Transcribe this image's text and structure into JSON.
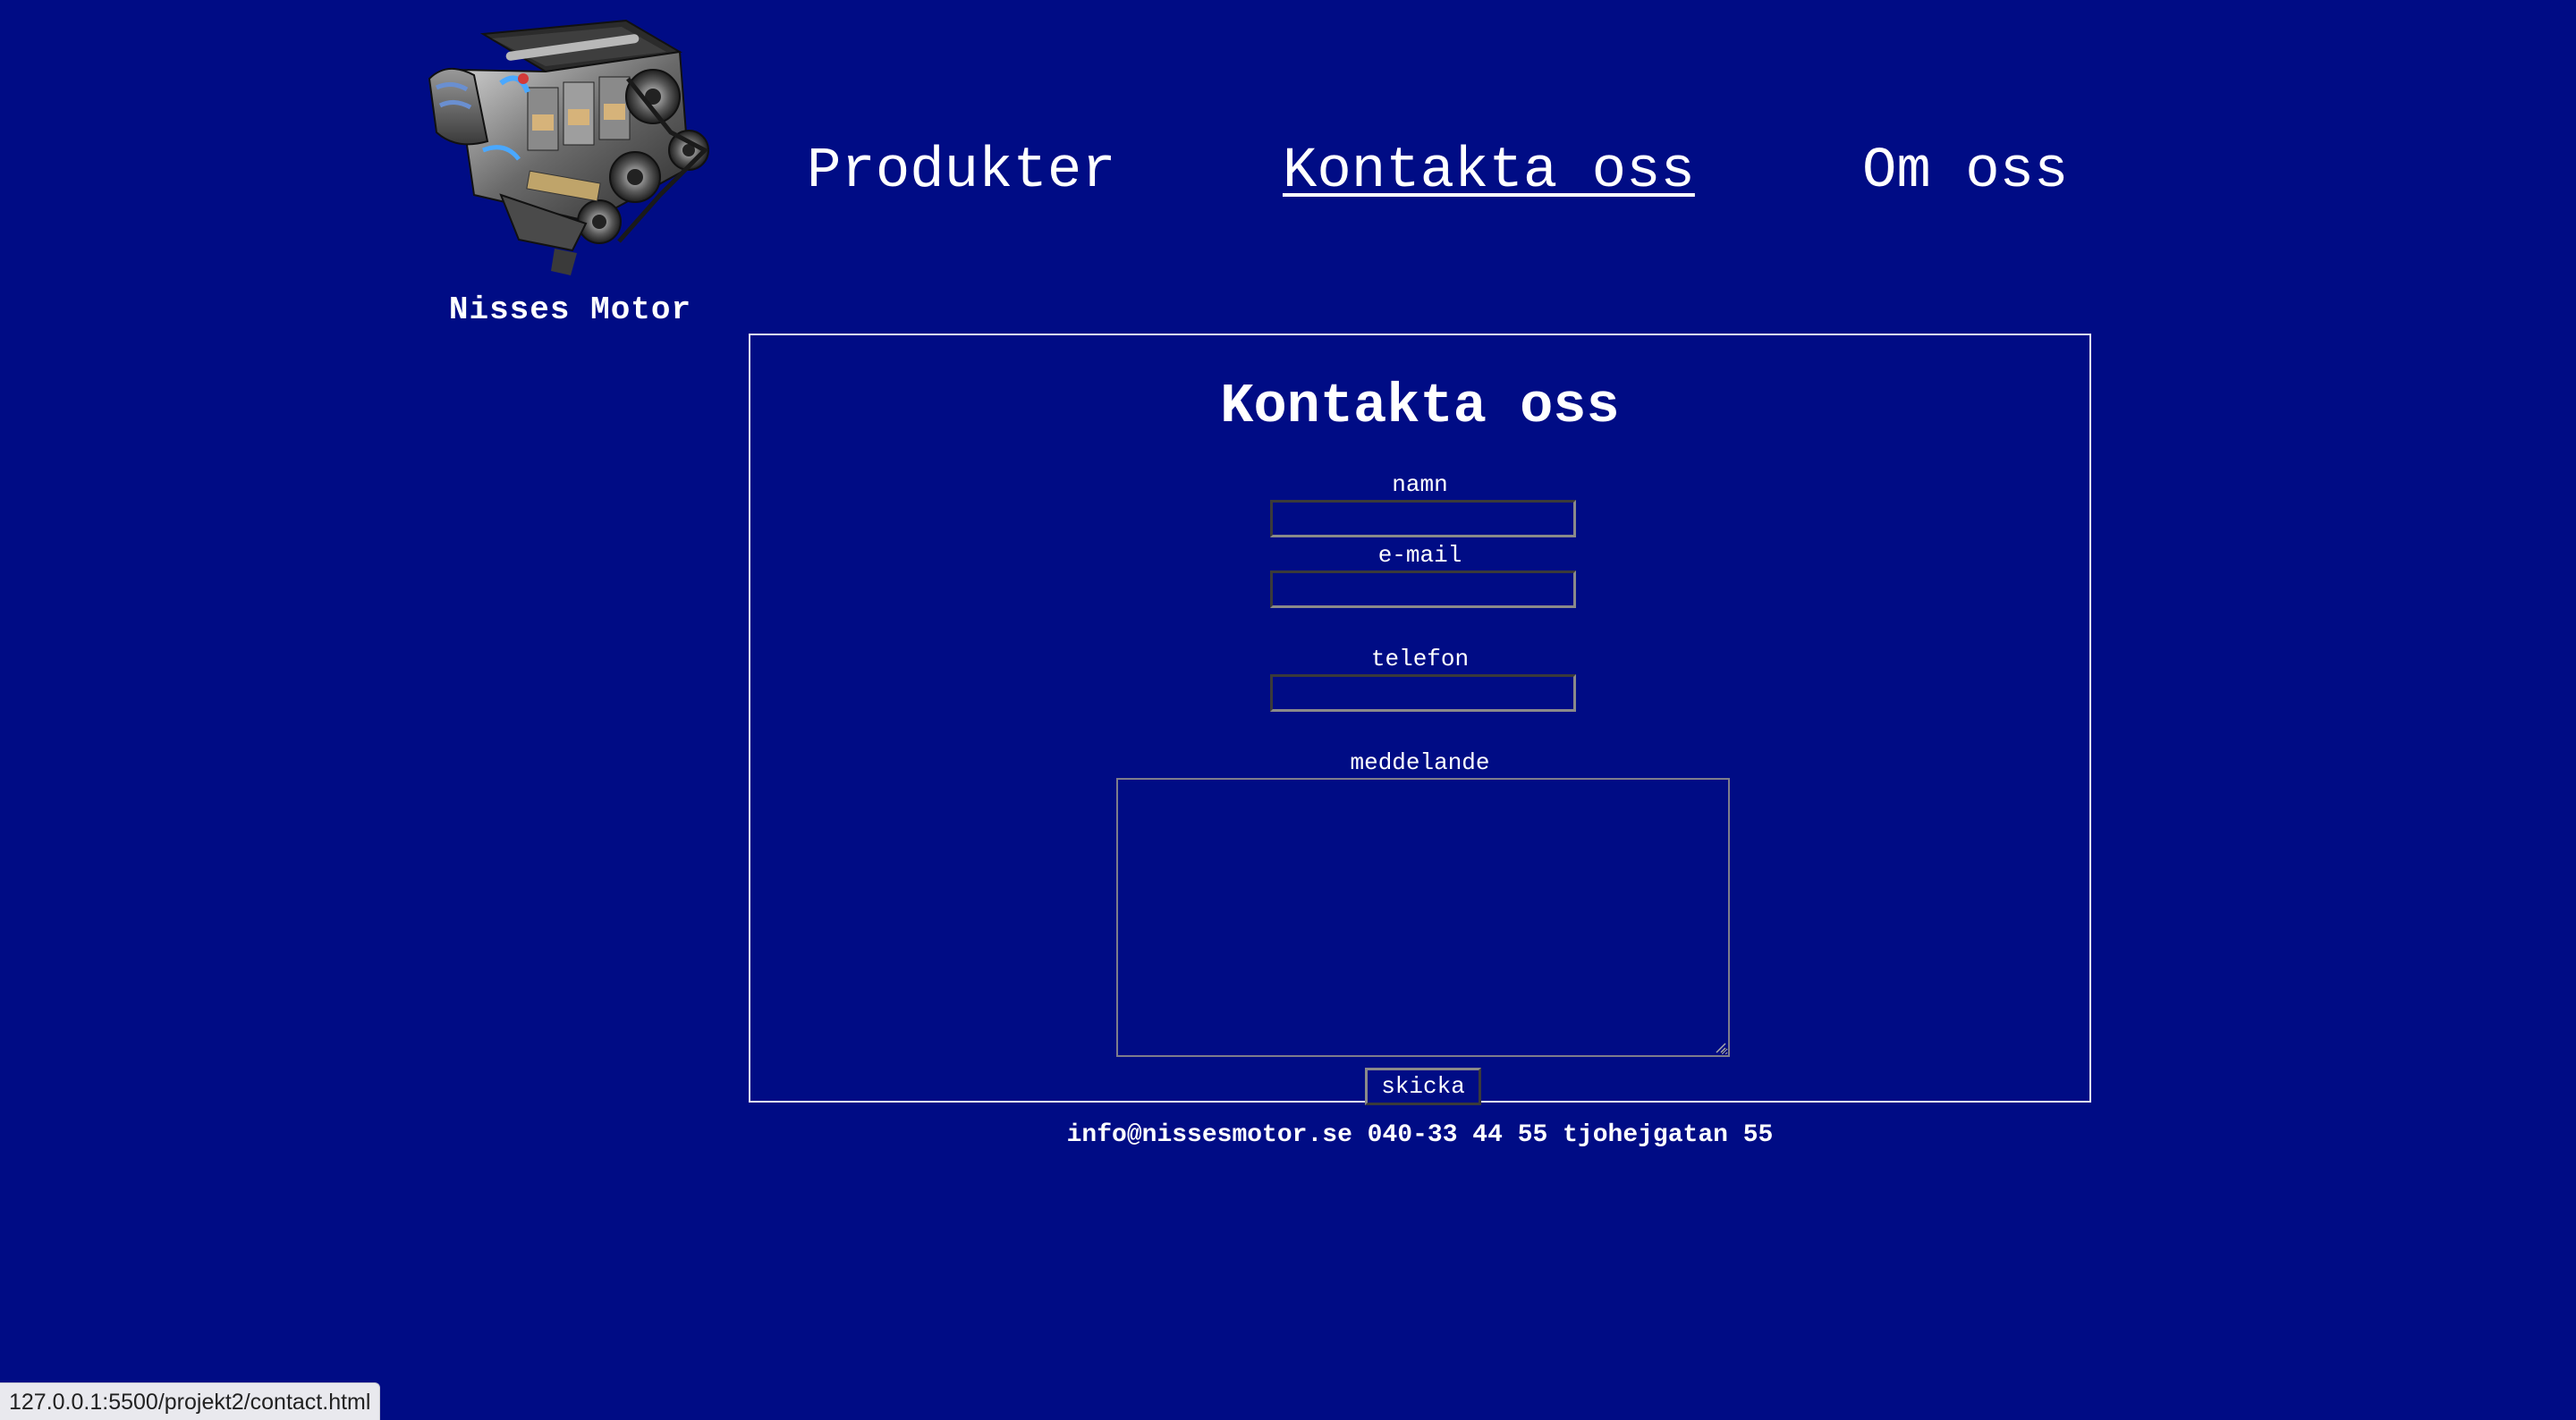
{
  "header": {
    "brand_name": "Nisses Motor",
    "logo_icon": "engine-icon"
  },
  "nav": {
    "items": [
      {
        "label": "Produkter",
        "active": false
      },
      {
        "label": "Kontakta oss",
        "active": true
      },
      {
        "label": "Om oss",
        "active": false
      }
    ]
  },
  "form": {
    "title": "Kontakta oss",
    "fields": {
      "name_label": "namn",
      "name_value": "",
      "email_label": "e-mail",
      "email_value": "",
      "phone_label": "telefon",
      "phone_value": "",
      "message_label": "meddelande",
      "message_value": ""
    },
    "submit_label": "skicka"
  },
  "footer": {
    "contact_line": "info@nissesmotor.se 040-33 44 55 tjohejgatan 55"
  },
  "status_bar": {
    "url": "127.0.0.1:5500/projekt2/contact.html"
  },
  "colors": {
    "background": "#000c85",
    "text": "#ffffff",
    "border": "#e8e8f0"
  }
}
